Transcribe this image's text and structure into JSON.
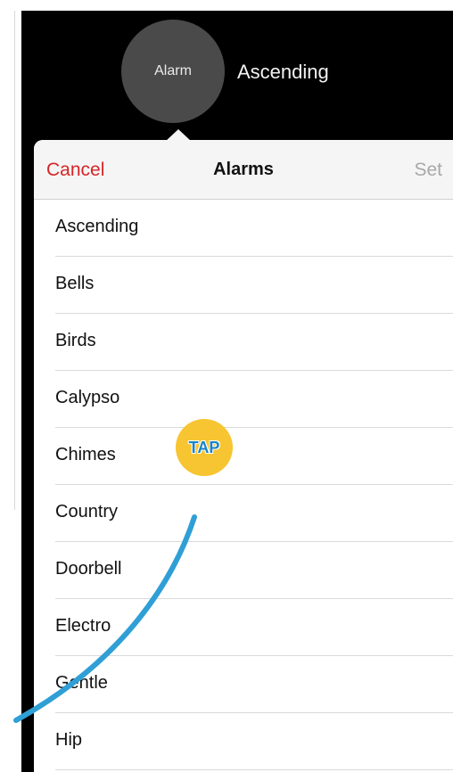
{
  "top": {
    "circle_label": "Alarm",
    "value": "Ascending"
  },
  "nav": {
    "cancel": "Cancel",
    "title": "Alarms",
    "set": "Set"
  },
  "list": {
    "items": [
      {
        "label": "Ascending"
      },
      {
        "label": "Bells"
      },
      {
        "label": "Birds"
      },
      {
        "label": "Calypso"
      },
      {
        "label": "Chimes"
      },
      {
        "label": "Country"
      },
      {
        "label": "Doorbell"
      },
      {
        "label": "Electro"
      },
      {
        "label": "Gentle"
      },
      {
        "label": "Hip"
      }
    ]
  },
  "annotation": {
    "tap_label": "TAP"
  },
  "colors": {
    "cancel_red": "#d72527",
    "tap_yellow": "#f7c531",
    "curve_blue": "#2f9fd6"
  }
}
